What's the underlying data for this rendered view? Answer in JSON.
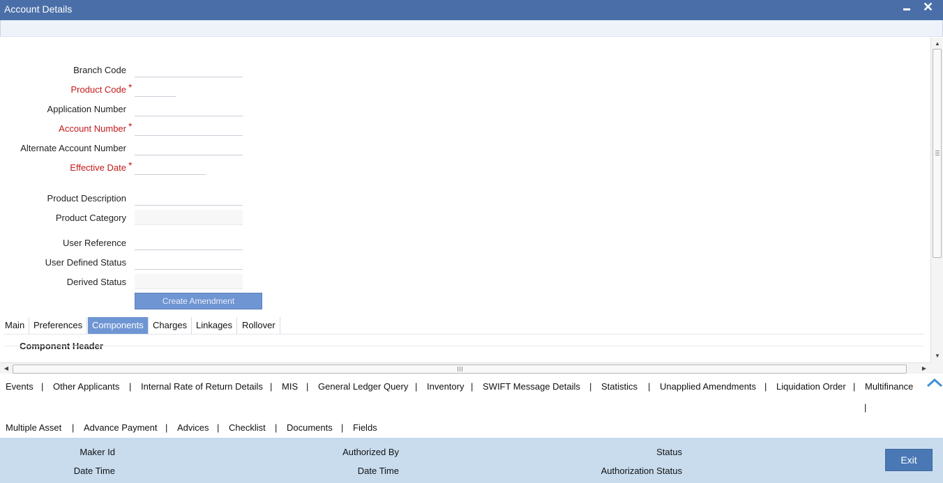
{
  "window": {
    "title": "Account Details",
    "minimize_label": "",
    "close_label": "✕"
  },
  "form": {
    "branch_code": {
      "label": "Branch Code",
      "value": ""
    },
    "product_code": {
      "label": "Product Code",
      "value": "",
      "required": true
    },
    "application_number": {
      "label": "Application Number",
      "value": ""
    },
    "account_number": {
      "label": "Account Number",
      "value": "",
      "required": true
    },
    "alternate_account_number": {
      "label": "Alternate Account Number",
      "value": ""
    },
    "effective_date": {
      "label": "Effective Date",
      "value": "",
      "required": true
    },
    "product_description": {
      "label": "Product Description",
      "value": ""
    },
    "product_category": {
      "label": "Product Category",
      "value": ""
    },
    "user_reference": {
      "label": "User Reference",
      "value": ""
    },
    "user_defined_status": {
      "label": "User Defined Status",
      "value": ""
    },
    "derived_status": {
      "label": "Derived Status",
      "value": ""
    },
    "required_marker": "*",
    "create_amendment_label": "Create Amendment"
  },
  "tabs": [
    {
      "label": "Main",
      "active": false
    },
    {
      "label": "Preferences",
      "active": false
    },
    {
      "label": "Components",
      "active": true
    },
    {
      "label": "Charges",
      "active": false
    },
    {
      "label": "Linkages",
      "active": false
    },
    {
      "label": "Rollover",
      "active": false
    }
  ],
  "component_header": "Component Header",
  "links_row1": [
    "Events",
    "Other Applicants",
    "Internal Rate of Return Details",
    "MIS",
    "General Ledger Query",
    "Inventory",
    "SWIFT Message Details",
    "Statistics",
    "Unapplied Amendments",
    "Liquidation Order",
    "Multifinance"
  ],
  "links_row2": [
    "Multiple Asset",
    "Advance Payment",
    "Advices",
    "Checklist",
    "Documents",
    "Fields"
  ],
  "separator": "|",
  "footer": {
    "maker_id": "Maker Id",
    "maker_date_time": "Date Time",
    "authorized_by": "Authorized By",
    "auth_date_time": "Date Time",
    "status": "Status",
    "authorization_status": "Authorization Status",
    "exit_label": "Exit"
  },
  "colors": {
    "title_bar": "#4a6fa8",
    "active_tab": "#6f95d3",
    "required_label": "#c41a1a",
    "footer_bg": "#c8dcee",
    "exit_button": "#4a78b5"
  }
}
